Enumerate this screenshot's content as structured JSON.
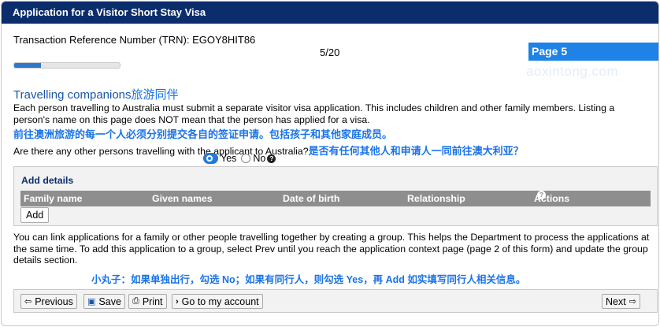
{
  "header": {
    "title": "Application for a Visitor Short Stay Visa"
  },
  "trn": "Transaction Reference Number (TRN): EGOY8HIT86",
  "page": {
    "counter": "5/20",
    "progress_fraction": 0.25,
    "badge": "Page 5"
  },
  "watermark": "aoxintong.com",
  "section": {
    "title": "Travelling companions",
    "title_cn": "旅游同伴",
    "description": "Each person travelling to Australia must submit a separate visitor visa application. This includes children and other family members. Listing a person's name on this page does NOT mean that the person has applied for a visa.",
    "description_cn": "前往澳洲旅游的每一个人必须分别提交各自的签证申请。包括孩子和其他家庭成员。"
  },
  "question": {
    "text": "Are there any other persons travelling with the applicant to Australia?",
    "text_cn": "是否有任何其他人和申请人一同前往澳大利亚？",
    "options": [
      "Yes",
      "No"
    ],
    "selected": "Yes"
  },
  "add_details": {
    "title": "Add details",
    "columns": [
      "Family name",
      "Given names",
      "Date of birth",
      "Relationship",
      "Actions"
    ],
    "add_label": "Add"
  },
  "group_info": "You can link applications for a family or other people travelling together by creating a group. This helps the Department to process the applications at the same time. To add this application to a group, select Prev until you reach the application context page (page 2 of this form) and update the group details section.",
  "note_cn": "小丸子：如果单独出行，勾选 No；如果有同行人，则勾选 Yes，再 Add 如实填写同行人相关信息。",
  "footer": {
    "previous": "Previous",
    "save": "Save",
    "print": "Print",
    "account": "Go to my account",
    "next": "Next"
  },
  "colors": {
    "header": "#0b2d6b",
    "accent": "#1e82e6",
    "annotation": "#1a73e8"
  }
}
